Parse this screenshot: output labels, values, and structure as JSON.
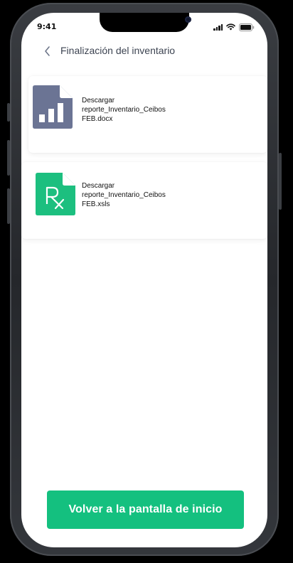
{
  "status_bar": {
    "time": "9:41"
  },
  "header": {
    "title": "Finalización del inventario",
    "back_icon": "chevron-left-icon"
  },
  "downloads": [
    {
      "lines": [
        "Descargar",
        "reporte_Inventario_Ceibos",
        "FEB.docx"
      ],
      "icon": "bar-chart-document-icon",
      "icon_color": "#6b7494"
    },
    {
      "lines": [
        "Descargar",
        "reporte_Inventario_Ceibos",
        "FEB.xsls"
      ],
      "icon": "rx-document-icon",
      "icon_color": "#1cbf7f"
    }
  ],
  "footer": {
    "primary_button": "Volver a la pantalla de inicio",
    "primary_color": "#14c07f"
  }
}
